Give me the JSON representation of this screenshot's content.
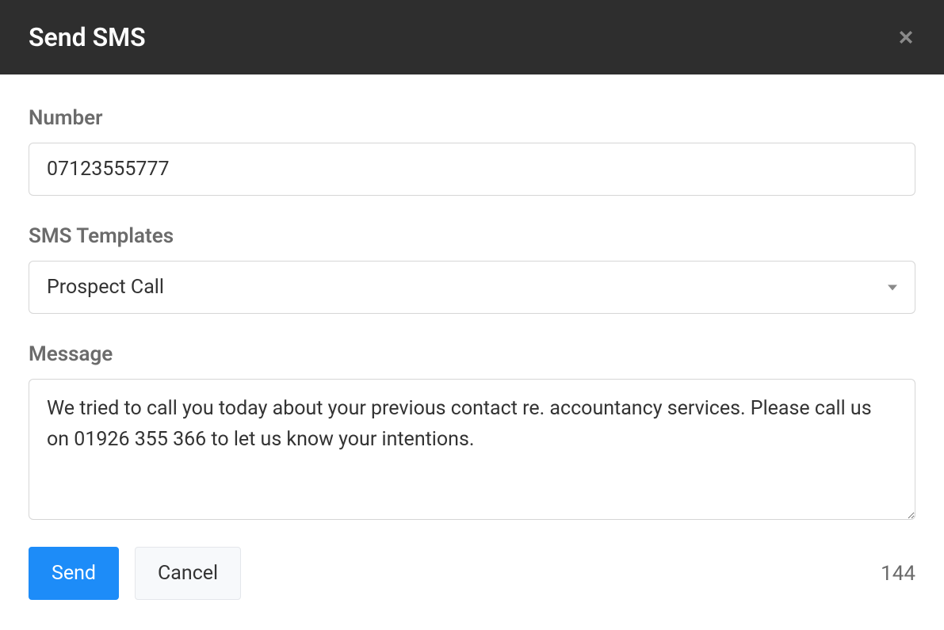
{
  "header": {
    "title": "Send SMS"
  },
  "form": {
    "number": {
      "label": "Number",
      "value": "07123555777"
    },
    "templates": {
      "label": "SMS Templates",
      "selected": "Prospect Call"
    },
    "message": {
      "label": "Message",
      "value": "We tried to call you today about your previous contact re. accountancy services. Please call us on 01926 355 366 to let us know your intentions."
    }
  },
  "actions": {
    "send_label": "Send",
    "cancel_label": "Cancel",
    "char_count": "144"
  }
}
